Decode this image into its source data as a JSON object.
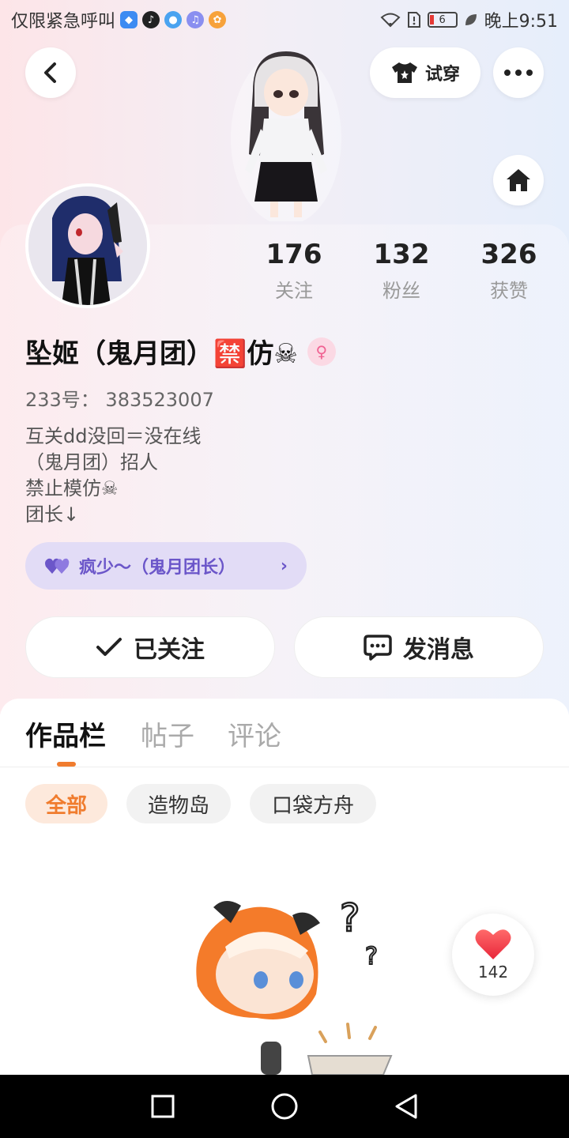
{
  "status_bar": {
    "left_text": "仅限紧急呼叫",
    "battery": "6",
    "time": "晚上9:51"
  },
  "header": {
    "try_on_label": "试穿"
  },
  "stats": [
    {
      "num": "176",
      "label": "关注"
    },
    {
      "num": "132",
      "label": "粉丝"
    },
    {
      "num": "326",
      "label": "获赞"
    }
  ],
  "profile": {
    "name": "坠姬（鬼月团）🈲仿☠",
    "gender_symbol": "♀",
    "uid": "233号：  383523007",
    "bio": "互关dd没回＝没在线\n（鬼月团）招人\n禁止模仿☠\n团长↓",
    "guild_label": "疯少～（鬼月团长）"
  },
  "actions": {
    "follow_label": "已关注",
    "message_label": "发消息"
  },
  "tabs": [
    {
      "label": "作品栏"
    },
    {
      "label": "帖子"
    },
    {
      "label": "评论"
    }
  ],
  "chips": [
    {
      "label": "全部"
    },
    {
      "label": "造物岛"
    },
    {
      "label": "口袋方舟"
    }
  ],
  "like": {
    "count": "142"
  },
  "colors": {
    "accent": "#f07c2e",
    "guild": "#6b56c9",
    "heart": "#f0454f"
  }
}
